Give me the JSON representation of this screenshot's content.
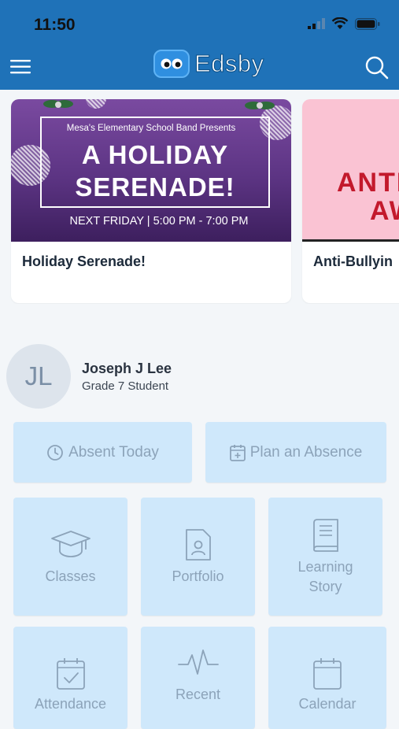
{
  "status": {
    "time": "11:50"
  },
  "app": {
    "name": "Edsby"
  },
  "carousel": [
    {
      "title": "Holiday Serenade!",
      "banner": {
        "preheading": "Mesa's Elementary School Band Presents",
        "heading_line1": "A HOLIDAY",
        "heading_line2": "SERENADE!",
        "when": "NEXT FRIDAY | 5:00 PM - 7:00 PM"
      }
    },
    {
      "title": "Anti-Bullyin",
      "banner": {
        "line1": "ANTI",
        "line2": "AW"
      }
    }
  ],
  "profile": {
    "initials": "JL",
    "name": "Joseph J Lee",
    "subtitle": "Grade 7 Student"
  },
  "actions": {
    "absent": "Absent Today",
    "plan": "Plan an Absence"
  },
  "tiles": {
    "classes": "Classes",
    "portfolio": "Portfolio",
    "learning_story_1": "Learning",
    "learning_story_2": "Story",
    "attendance": "Attendance",
    "recent": "Recent",
    "calendar": "Calendar"
  },
  "colors": {
    "brand": "#1f72b8",
    "tile": "#cfe8fb",
    "tile_text": "#8ca3b9"
  }
}
